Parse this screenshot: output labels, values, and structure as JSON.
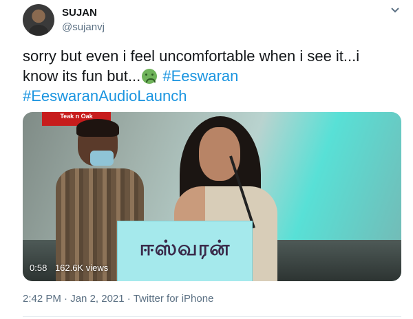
{
  "user": {
    "name": "SUJAN",
    "handle": "@sujanvj"
  },
  "tweet": {
    "text_before": "sorry but even i feel uncomfortable when i see it...i know its fun but...",
    "emoji": "nauseated-face-emoji",
    "hashtag1": "#Eeswaran",
    "hashtag2": "#EeswaranAudioLaunch"
  },
  "video": {
    "duration": "0:58",
    "views": "162.6K views",
    "podium_text": "ஈஸ்வரன்",
    "banner_text": "Teak n Oak"
  },
  "footer": {
    "time": "2:42 PM",
    "sep1": " · ",
    "date": "Jan 2, 2021",
    "sep2": " · ",
    "source": "Twitter for iPhone"
  },
  "colors": {
    "link": "#1b95e0",
    "muted": "#5b7083"
  }
}
